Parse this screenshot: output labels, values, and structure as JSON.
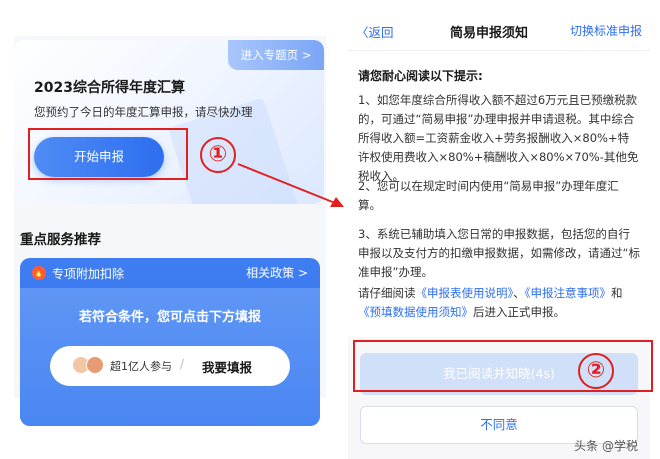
{
  "left": {
    "topic_link": "进入专题页 >",
    "hero_title": "2023综合所得年度汇算",
    "hero_subtitle": "您预约了今日的年度汇算申报，请尽快办理",
    "start_button": "开始申报",
    "marker_1": "①",
    "section_title": "重点服务推荐",
    "service": {
      "label": "专项附加扣除",
      "policy_link": "相关政策 >",
      "prompt": "若符合条件，您可点击下方填报",
      "participants": "超1亿人参与",
      "divider": "/",
      "fill_label": "我要填报"
    }
  },
  "right": {
    "back": "〈返回",
    "title": "简易申报须知",
    "switch": "切换标准申报",
    "heading": "请您耐心阅读以下提示:",
    "p1": "1、如您年度综合所得收入额不超过6万元且已预缴税款的，可通过“简易申报”办理申报并申请退税。其中综合所得收入额=工资薪金收入+劳务报酬收入×80%+特许权使用费收入×80%+稿酬收入×80%×70%-其他免税收入。",
    "p2": "2、您可以在规定时间内使用“简易申报”办理年度汇算。",
    "p3": "3、系统已辅助填入您日常的申报数据，包括您的自行申报以及支付方的扣缴申报数据，如需修改，请通过“标准申报”办理。",
    "p4_prefix": "请仔细阅读",
    "link1": "《申报表使用说明》",
    "sep": "、",
    "link2": "《申报注意事项》",
    "p4_and": "和",
    "link3": "《预填数据使用须知》",
    "p4_suffix": "后进入正式申报。",
    "agree_button": "我已阅读并知晓(4s)",
    "disagree_button": "不同意",
    "marker_2": "②",
    "watermark": "头条 @学税"
  },
  "colors": {
    "accent": "#2d6ef0",
    "annotation": "#e02020"
  }
}
